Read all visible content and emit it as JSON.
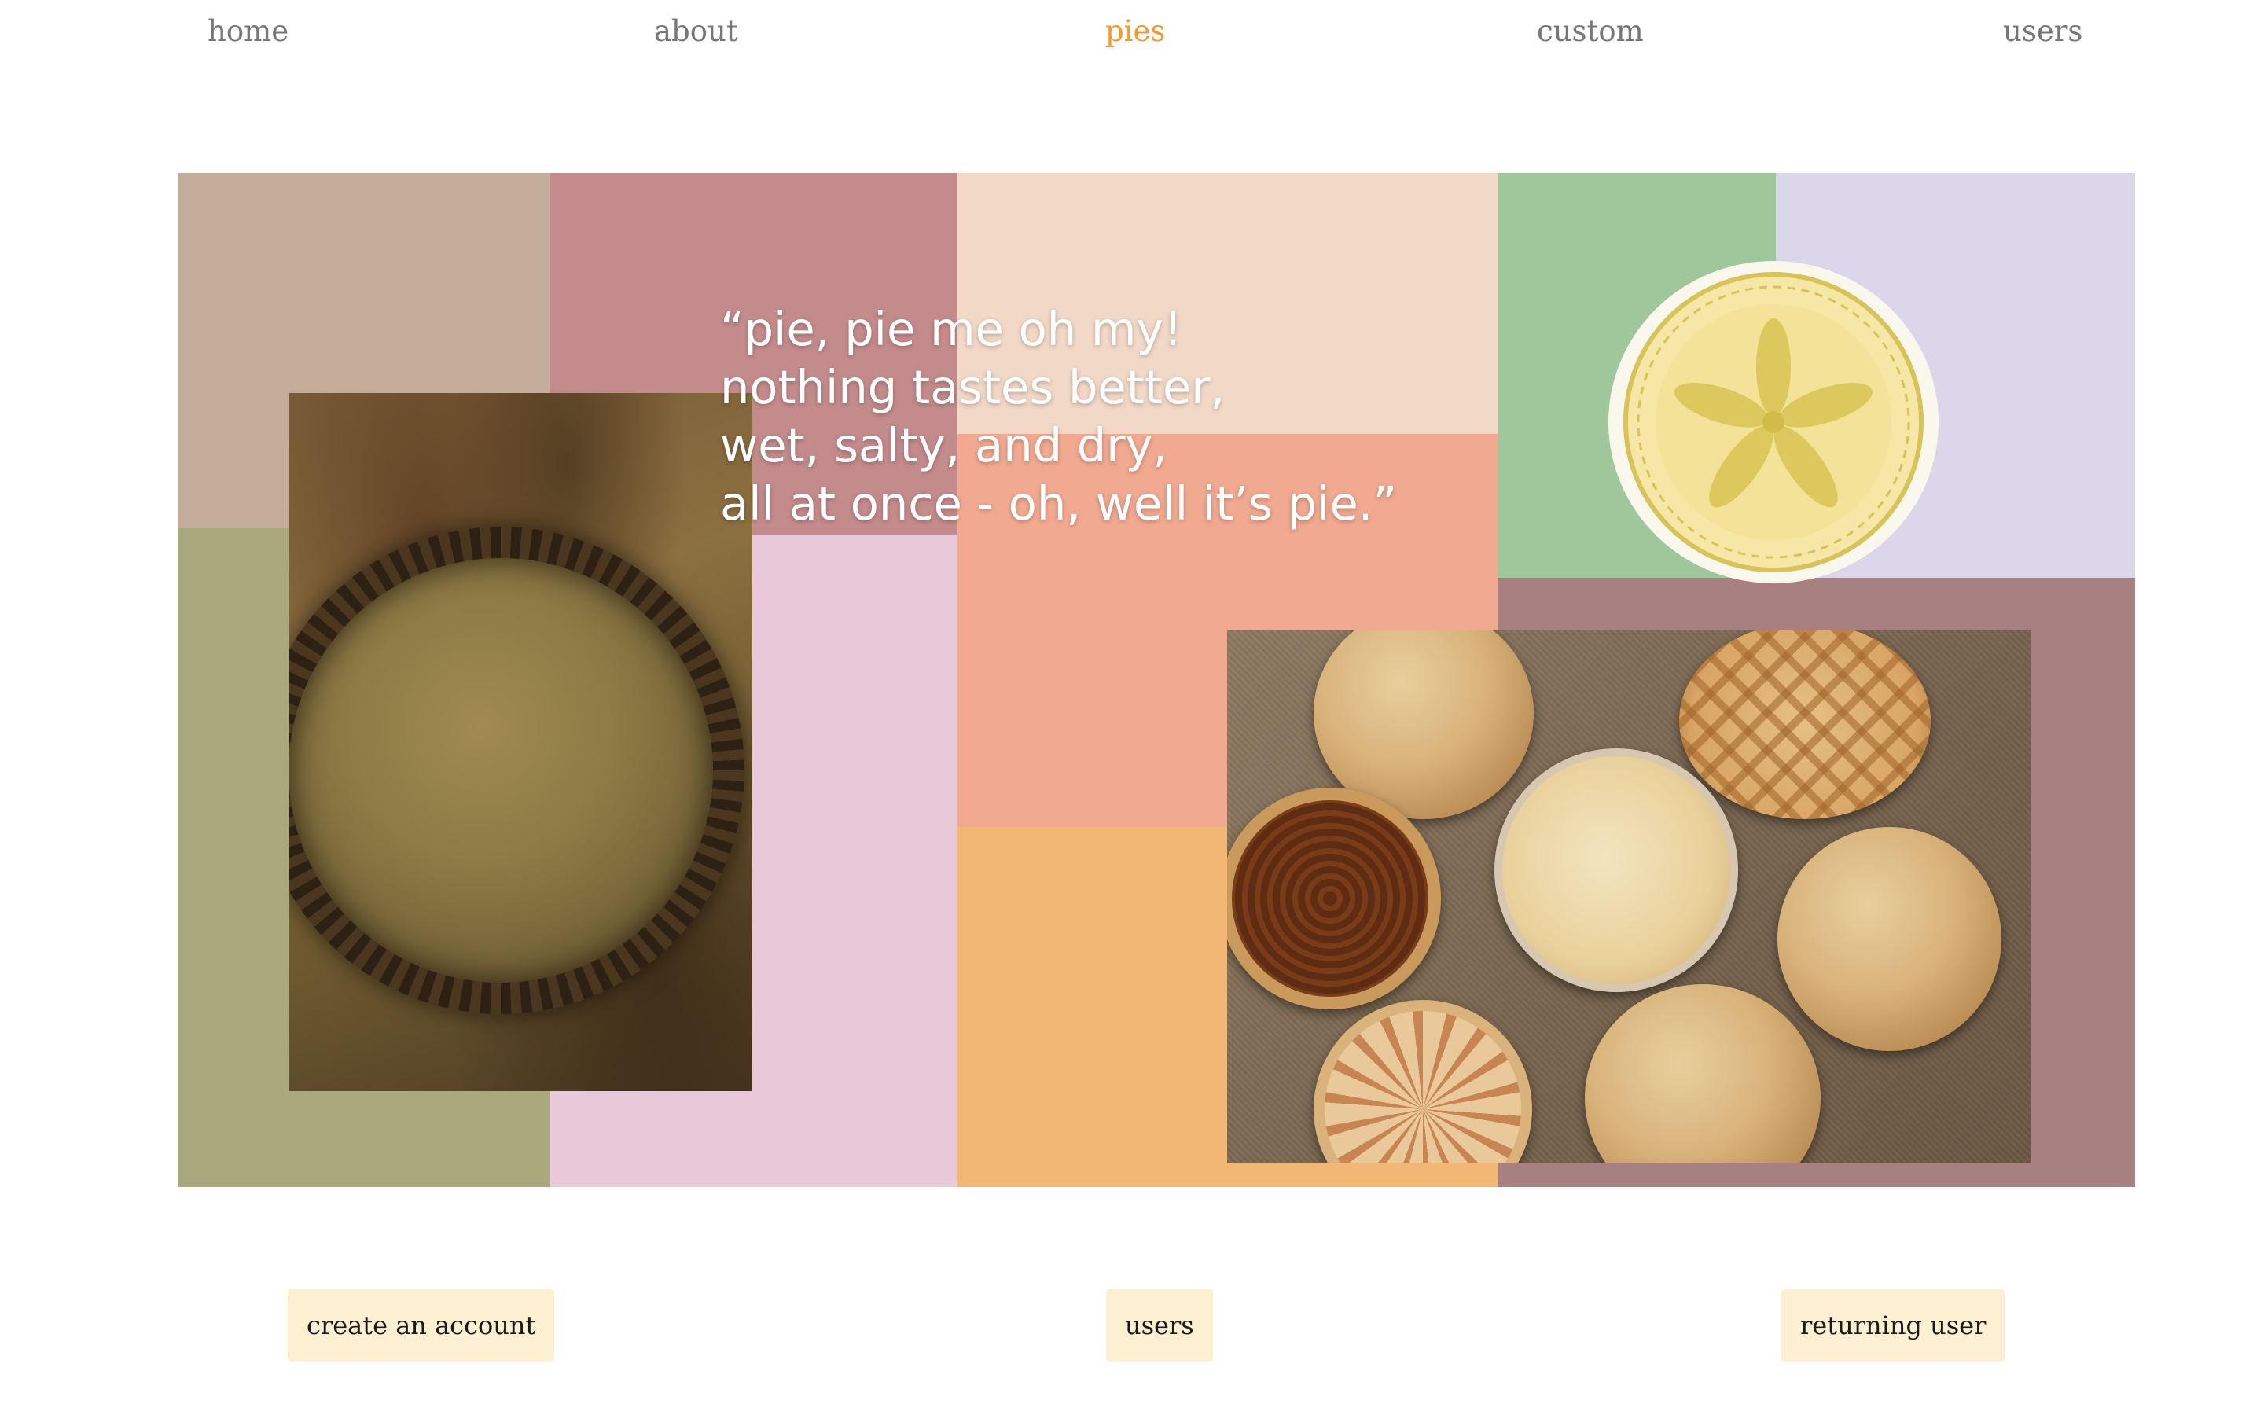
{
  "nav": {
    "items": [
      {
        "label": "home"
      },
      {
        "label": "about"
      },
      {
        "label": "pies"
      },
      {
        "label": "custom"
      },
      {
        "label": "users"
      }
    ],
    "active": "pies"
  },
  "hero": {
    "quote_lines": [
      "“pie, pie me oh my!",
      "nothing tastes better,",
      "wet, salty, and dry,",
      "all at once - oh, well it’s pie.”"
    ],
    "images": {
      "left_photo": "empty fluted tart pan",
      "right_photo": "assorted baked pies",
      "illustration": "pie-illustration-icon"
    }
  },
  "buttons": {
    "create_account": "create an account",
    "users": "users",
    "returning_user": "returning user"
  },
  "colors": {
    "nav_text": "#777777",
    "nav_active": "#f29b2c",
    "button_bg": "#fcefd2",
    "palette": [
      "#c3ad9a",
      "#c48b8c",
      "#f2d8c7",
      "#a0c69c",
      "#dcd6eb",
      "#a9a97d",
      "#e9c8d9",
      "#f1a991",
      "#f2b774",
      "#a98081"
    ]
  }
}
